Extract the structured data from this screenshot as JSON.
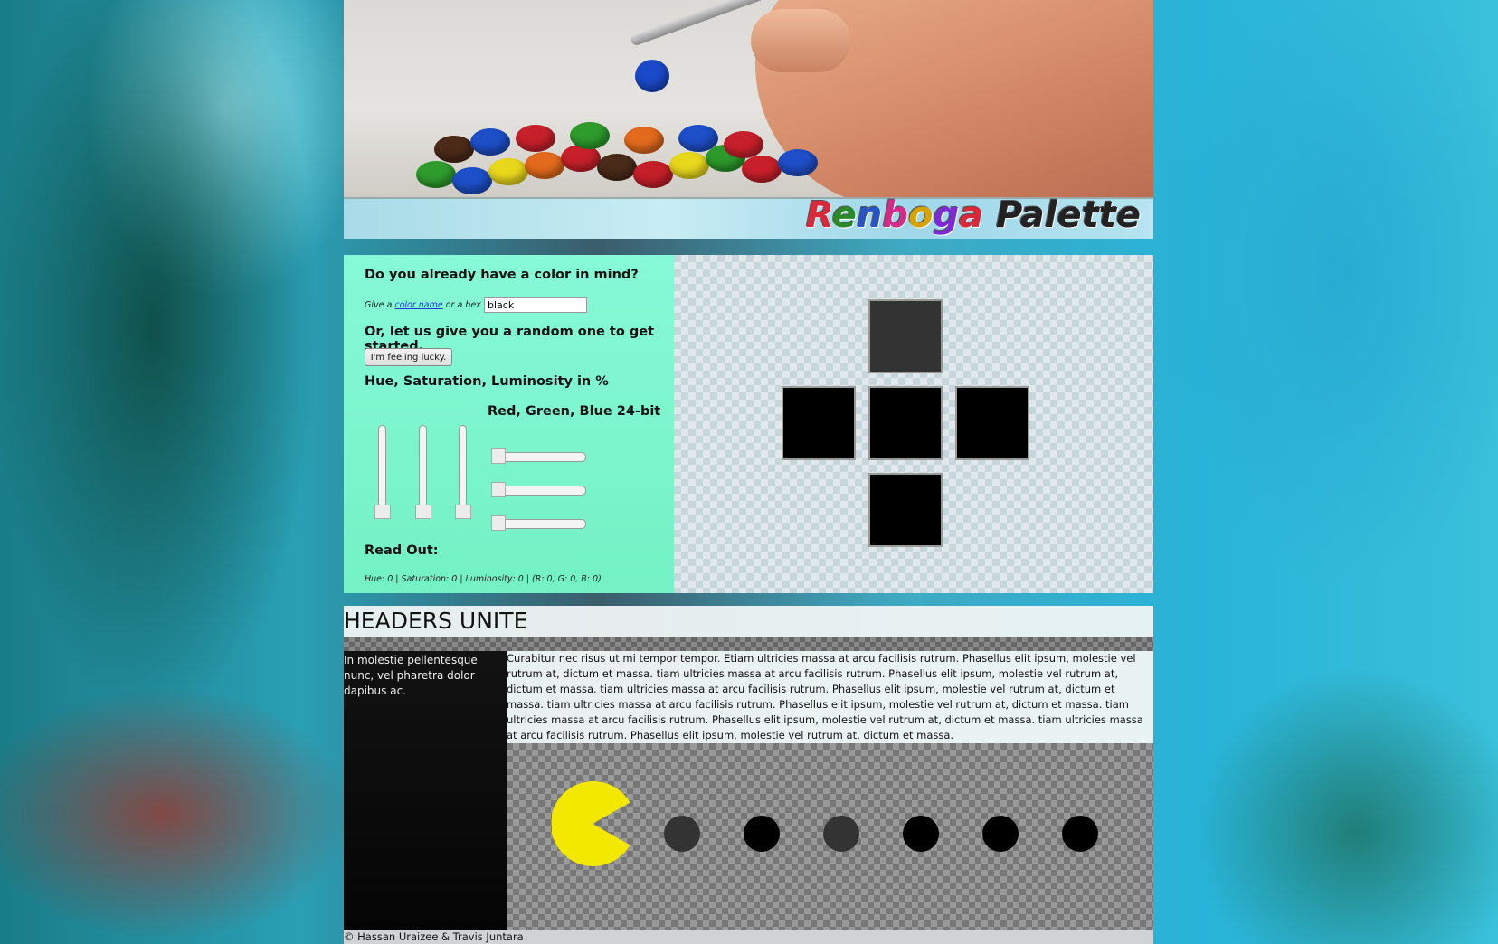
{
  "banner": {
    "title_parts": [
      "R",
      "e",
      "n",
      "b",
      "o",
      "g",
      "a",
      " Palette"
    ]
  },
  "picker": {
    "heading": "Do you already have a color in mind?",
    "give_prefix": "Give a",
    "color_name_link": "color name",
    "give_suffix": "or a hex code",
    "input_value": "black",
    "random_heading": "Or, let us give you a random one to get started.",
    "lucky_button": "I'm feeling lucky.",
    "hsl_heading": "Hue, Saturation, Luminosity in %",
    "rgb_heading": "Red, Green, Blue 24-bit",
    "readout_heading": "Read Out:",
    "readout_text": "Hue: 0 | Saturation: 0 | Luminosity: 0 | (R: 0, G: 0, B: 0)",
    "hsl_values": [
      0,
      0,
      0
    ],
    "rgb_values": [
      0,
      0,
      0
    ]
  },
  "swatches": {
    "top": "#333333",
    "left": "#000000",
    "center": "#000000",
    "right": "#000000",
    "bottom": "#000000"
  },
  "content": {
    "header": "HEADERS UNITE",
    "sidebar_text": "In molestie pellentesque nunc, vel pharetra dolor dapibus ac.",
    "article_text": "Curabitur nec risus ut mi tempor tempor. Etiam ultricies massa at arcu facilisis rutrum. Phasellus elit ipsum, molestie vel rutrum at, dictum et massa. tiam ultricies massa at arcu facilisis rutrum. Phasellus elit ipsum, molestie vel rutrum at, dictum et massa. tiam ultricies massa at arcu facilisis rutrum. Phasellus elit ipsum, molestie vel rutrum at, dictum et massa. tiam ultricies massa at arcu facilisis rutrum. Phasellus elit ipsum, molestie vel rutrum at, dictum et massa. tiam ultricies massa at arcu facilisis rutrum. Phasellus elit ipsum, molestie vel rutrum at, dictum et massa. tiam ultricies massa at arcu facilisis rutrum. Phasellus elit ipsum, molestie vel rutrum at, dictum et massa."
  },
  "pacman": {
    "color": "#f2e800",
    "dot_colors": [
      "#333333",
      "#000000",
      "#333333",
      "#000000",
      "#000000",
      "#000000"
    ]
  },
  "footer": {
    "text": "© Hassan Uraizee & Travis Juntara"
  }
}
